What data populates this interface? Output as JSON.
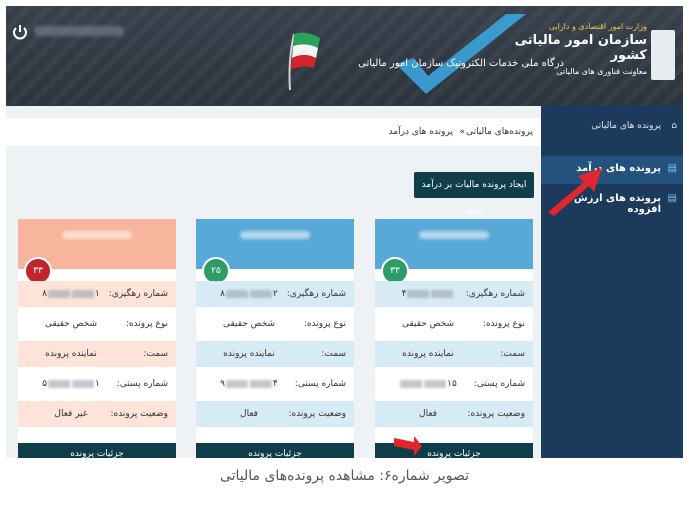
{
  "header": {
    "ministry": "وزارت امور اقتصادی و دارایی",
    "org_name": "سازمان امور مالیاتی کشور",
    "deputy": "معاونت فناوری های مالیاتی",
    "portal_title": "درگاه ملی خدمات الکترونیک سازمان امور مالیاتی"
  },
  "sidebar": {
    "home_label": "پرونده های مالیاتی",
    "items": [
      {
        "label": "پرونده های درآمد"
      },
      {
        "label": "پرونده های ارزش افزوده"
      }
    ]
  },
  "breadcrumb": {
    "parent": "پرونده‌های مالیاتی",
    "separator": "»",
    "current": "پرونده های درآمد"
  },
  "create_button": "ایجاد پرونده مالیات بر درآمد جدید",
  "cards": [
    {
      "badge": "۳۳",
      "color": "#58a9d8",
      "badge_color": "#2e9c68",
      "rows": [
        {
          "label": "شماره رهگیری:",
          "value_prefix": "",
          "value_suffix": "۴"
        },
        {
          "label": "نوع پرونده:",
          "value": "شخص حقیقی"
        },
        {
          "label": "سمت:",
          "value": "نماینده پرونده"
        },
        {
          "label": "شماره پستی:",
          "value_prefix": "۱۵",
          "value_suffix": ""
        },
        {
          "label": "وضعیت پرونده:",
          "value": "فعال"
        }
      ],
      "footer": "جزئیات پرونده"
    },
    {
      "badge": "۲۵",
      "color": "#58a9d8",
      "badge_color": "#2e9c68",
      "rows": [
        {
          "label": "شماره رهگیری:",
          "value_prefix": "۲",
          "value_suffix": "۸"
        },
        {
          "label": "نوع پرونده:",
          "value": "شخص حقیقی"
        },
        {
          "label": "سمت:",
          "value": "نماینده پرونده"
        },
        {
          "label": "شماره پستی:",
          "value_prefix": "۴",
          "value_suffix": "۹"
        },
        {
          "label": "وضعیت پرونده:",
          "value": "فعال"
        }
      ],
      "footer": "جزئیات پرونده"
    },
    {
      "badge": "۳۳",
      "color": "#f6b59c",
      "badge_color": "#c0272d",
      "rows": [
        {
          "label": "شماره رهگیری:",
          "value_prefix": "۱",
          "value_suffix": "۸"
        },
        {
          "label": "نوع پرونده:",
          "value": "شخص حقیقی"
        },
        {
          "label": "سمت:",
          "value": "نماینده پرونده"
        },
        {
          "label": "شماره پستی:",
          "value_prefix": "۱",
          "value_suffix": "۵"
        },
        {
          "label": "وضعیت پرونده:",
          "value": "غیر فعال"
        }
      ],
      "footer": "جزئیات پرونده"
    }
  ],
  "caption": "تصویر شماره۶: مشاهده پرونده‌های مالیاتی",
  "icons": [
    "power-icon",
    "home-icon",
    "doc-icon",
    "flag-icon",
    "emblem-icon"
  ]
}
